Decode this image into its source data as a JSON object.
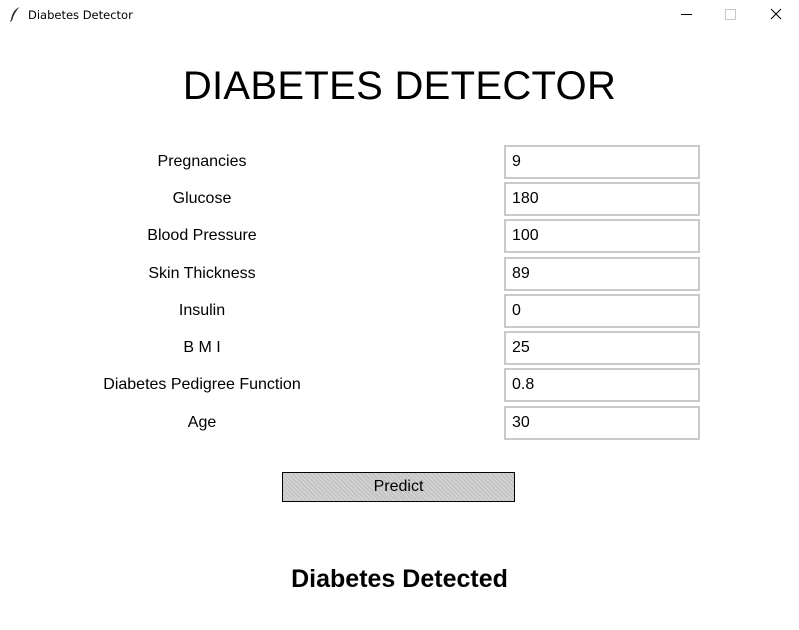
{
  "window": {
    "title": "Diabetes Detector",
    "icon": "feather-icon",
    "controls": [
      "minimize-icon",
      "maximize-icon",
      "close-icon"
    ]
  },
  "heading": "DIABETES DETECTOR",
  "fields": [
    {
      "label": "Pregnancies",
      "value": "9"
    },
    {
      "label": "Glucose",
      "value": "180"
    },
    {
      "label": "Blood Pressure",
      "value": "100"
    },
    {
      "label": "Skin Thickness",
      "value": "89"
    },
    {
      "label": "Insulin",
      "value": "0"
    },
    {
      "label": "B M I",
      "value": "25"
    },
    {
      "label": "Diabetes Pedigree Function",
      "value": "0.8"
    },
    {
      "label": "Age",
      "value": "30"
    }
  ],
  "predict_button": {
    "label": "Predict"
  },
  "result": "Diabetes Detected",
  "colors": {
    "input_border": "#c9c9c9",
    "button_bg": "#c4c4c4",
    "background": "#ffffff"
  }
}
